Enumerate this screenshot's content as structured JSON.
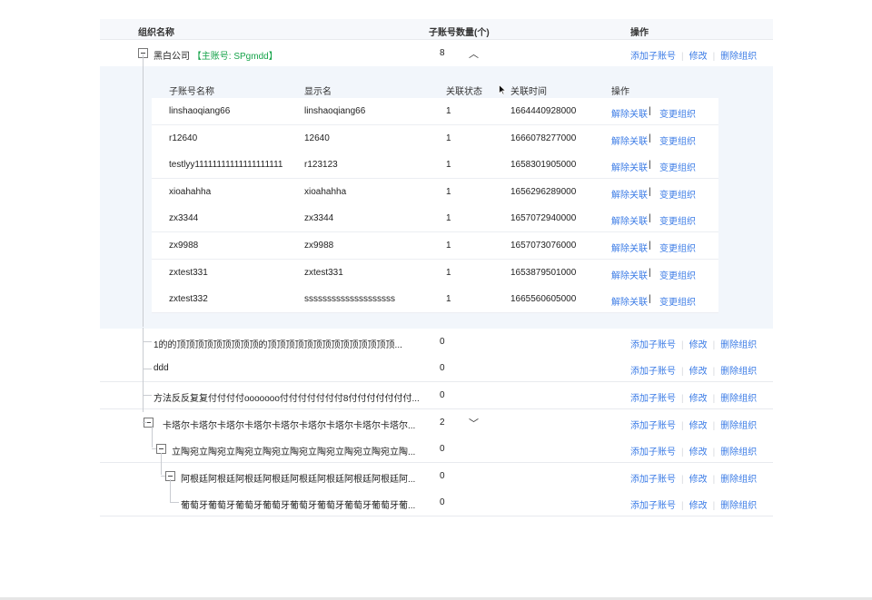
{
  "header": {
    "col_name": "组织名称",
    "col_count": "子账号数量(个)",
    "col_ops": "操作"
  },
  "ops": {
    "add": "添加子账号",
    "edit": "修改",
    "delete": "删除组织"
  },
  "root": {
    "name": "黑白公司",
    "tag": "【主账号: SPgmdd】",
    "count": "8"
  },
  "sub_table": {
    "headers": [
      "子账号名称",
      "显示名",
      "关联状态",
      "关联时间",
      "操作"
    ],
    "op_unlink": "解除关联",
    "op_change": "变更组织",
    "rows": [
      {
        "name": "linshaoqiang66",
        "display": "linshaoqiang66",
        "status": "1",
        "time": "1664440928000"
      },
      {
        "name": "r12640",
        "display": "12640",
        "status": "1",
        "time": "1666078277000"
      },
      {
        "name": "testlyy11111111111111111111",
        "display": "r123123",
        "status": "1",
        "time": "1658301905000"
      },
      {
        "name": "xioahahha",
        "display": "xioahahha",
        "status": "1",
        "time": "1656296289000"
      },
      {
        "name": "zx3344",
        "display": "zx3344",
        "status": "1",
        "time": "1657072940000"
      },
      {
        "name": "zx9988",
        "display": "zx9988",
        "status": "1",
        "time": "1657073076000"
      },
      {
        "name": "zxtest331",
        "display": "zxtest331",
        "status": "1",
        "time": "1653879501000"
      },
      {
        "name": "zxtest332",
        "display": "ssssssssssssssssssss",
        "status": "1",
        "time": "1665560605000"
      }
    ]
  },
  "orgs": [
    {
      "name": "1的的顶顶顶顶顶顶顶顶顶的顶顶顶顶顶顶顶顶顶顶顶顶顶顶...",
      "count": "0"
    },
    {
      "name": "ddd",
      "count": "0"
    },
    {
      "name": "方法反反复复付付付付ooooooo付付付付付付付8付付付付付付付...",
      "count": "0"
    },
    {
      "name": "卡塔尔卡塔尔卡塔尔卡塔尔卡塔尔卡塔尔卡塔尔卡塔尔卡塔尔...",
      "count": "2"
    },
    {
      "name": "立陶宛立陶宛立陶宛立陶宛立陶宛立陶宛立陶宛立陶宛立陶...",
      "count": "0"
    },
    {
      "name": "阿根廷阿根廷阿根廷阿根廷阿根廷阿根廷阿根廷阿根廷阿...",
      "count": "0"
    },
    {
      "name": "葡萄牙葡萄牙葡萄牙葡萄牙葡萄牙葡萄牙葡萄牙葡萄牙葡...",
      "count": "0"
    }
  ]
}
